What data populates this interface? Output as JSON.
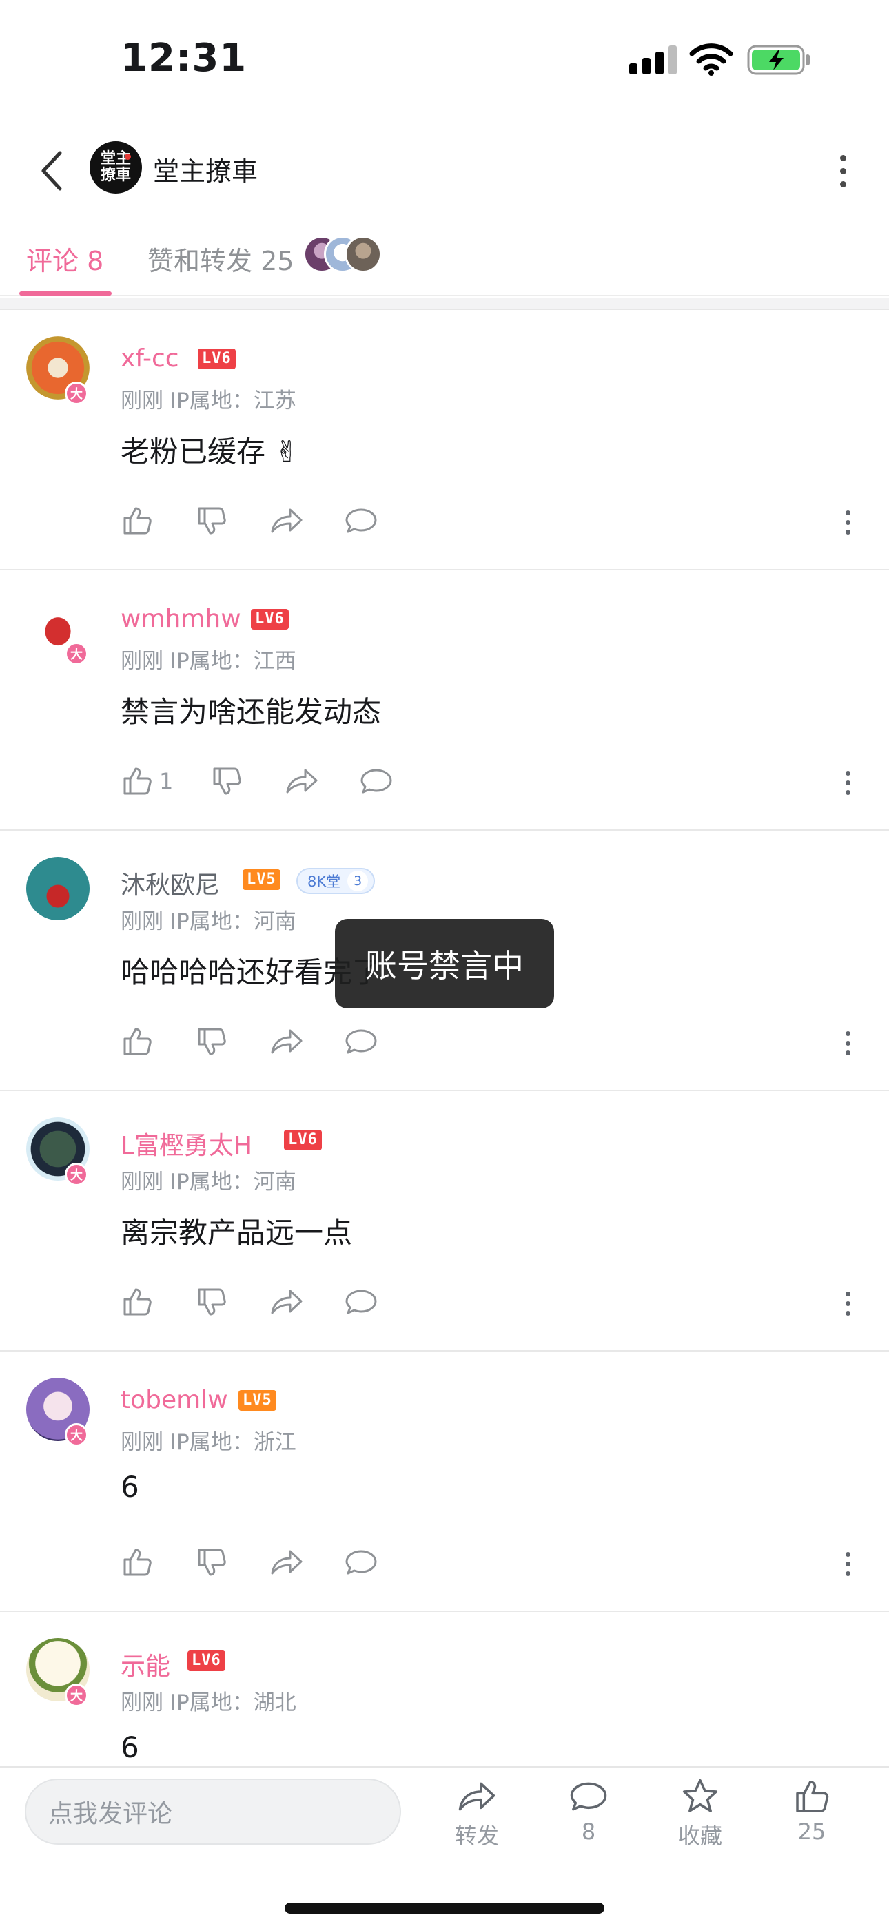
{
  "status_bar": {
    "time": "12:31"
  },
  "header": {
    "title": "堂主撩車",
    "avatar_text": "堂主撩車"
  },
  "tabs": [
    {
      "label": "评论 8",
      "active": true
    },
    {
      "label": "赞和转发 25",
      "active": false
    }
  ],
  "comments": [
    {
      "name": "xf-cc",
      "level": "LV6",
      "fans": null,
      "meta": "刚刚  IP属地：江苏",
      "text": "老粉已缓存 ✌",
      "likes": ""
    },
    {
      "name": "wmhmhw",
      "level": "LV6",
      "fans": null,
      "meta": "刚刚  IP属地：江西",
      "text": "禁言为啥还能发动态",
      "likes": "1"
    },
    {
      "name": "沐秋欧尼",
      "level": "LV5",
      "fans": {
        "label": "8K堂",
        "level": "3"
      },
      "meta": "刚刚  IP属地：河南",
      "text": "哈哈哈哈还好看完了",
      "likes": ""
    },
    {
      "name": "L富樫勇太H",
      "level": "LV6",
      "fans": null,
      "meta": "刚刚  IP属地：河南",
      "text": "离宗教产品远一点",
      "likes": ""
    },
    {
      "name": "tobemlw",
      "level": "LV5",
      "fans": null,
      "meta": "刚刚  IP属地：浙江",
      "text": "6",
      "likes": ""
    },
    {
      "name": "示能",
      "level": "LV6",
      "fans": null,
      "meta": "刚刚  IP属地：湖北",
      "text": "6",
      "likes": ""
    }
  ],
  "toast": {
    "text": "账号禁言中"
  },
  "bottom_bar": {
    "input_placeholder": "点我发评论",
    "share_label": "转发",
    "comment_count": "8",
    "favorite_label": "收藏",
    "like_count": "25"
  },
  "colors": {
    "accent": "#f06a99",
    "lv6": "#ee4046",
    "lv5": "#ff8a1f",
    "muted": "#9499a0"
  },
  "icons": [
    "back-arrow-icon",
    "more-vertical-icon",
    "thumb-up-icon",
    "thumb-down-icon",
    "share-arrow-icon",
    "comment-bubble-icon",
    "star-icon",
    "signal-icon",
    "wifi-icon",
    "battery-charging-icon"
  ]
}
